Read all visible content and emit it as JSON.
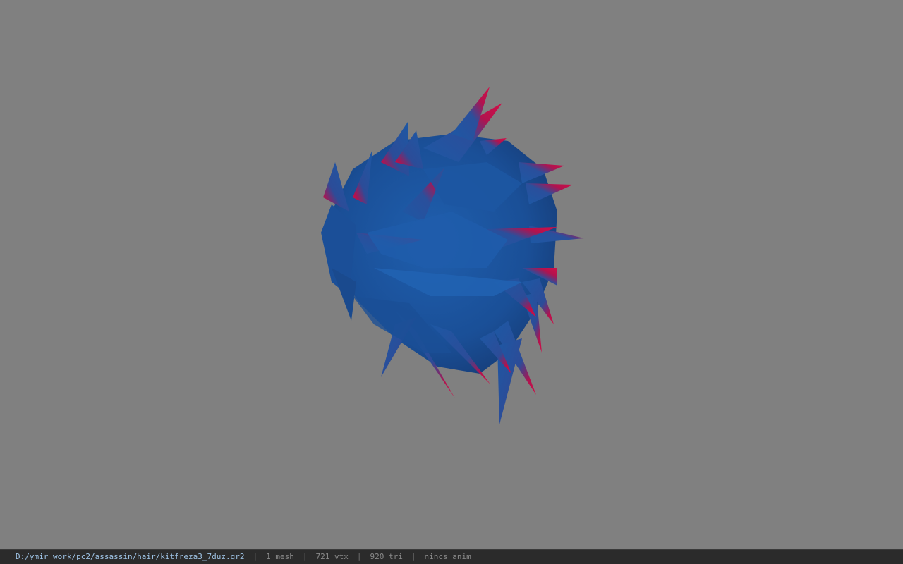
{
  "viewer": {
    "background_color": "#808080",
    "model": {
      "kind": "spiky hair mesh",
      "primary_color": "#1f5aa6",
      "tip_color": "#d0104a"
    }
  },
  "status_bar": {
    "file_path": "D:/ymir work/pc2/assassin/hair/kitfreza3_7duz.gr2",
    "mesh_count": "1 mesh",
    "vertex_count": "721 vtx",
    "triangle_count": "920 tri",
    "animation": "nincs anim",
    "separator": "|"
  }
}
